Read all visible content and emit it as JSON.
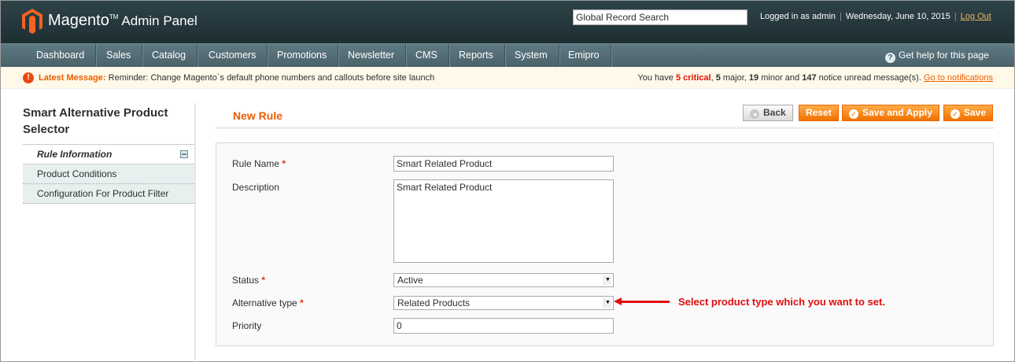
{
  "header": {
    "brand": "Magento",
    "brand_suffix": "Admin Panel",
    "search_value": "Global Record Search",
    "logged_in": "Logged in as admin",
    "date": "Wednesday, June 10, 2015",
    "logout": "Log Out"
  },
  "nav": {
    "items": [
      "Dashboard",
      "Sales",
      "Catalog",
      "Customers",
      "Promotions",
      "Newsletter",
      "CMS",
      "Reports",
      "System",
      "Emipro"
    ],
    "help": "Get help for this page"
  },
  "message": {
    "latest_label": "Latest Message:",
    "latest_text": "Reminder: Change Magento`s default phone numbers and callouts before site launch",
    "prefix": "You have",
    "critical_count": "5 critical",
    "major_count": "5",
    "major_label": "major,",
    "minor_count": "19",
    "minor_label": "minor and",
    "notice_count": "147",
    "notice_label": "notice unread message(s).",
    "link": "Go to notifications"
  },
  "sidebar": {
    "title": "Smart Alternative Product Selector",
    "tabs": [
      "Rule Information",
      "Product Conditions",
      "Configuration For Product Filter"
    ]
  },
  "main": {
    "title": "New Rule",
    "buttons": {
      "back": "Back",
      "reset": "Reset",
      "save_apply": "Save and Apply",
      "save": "Save"
    },
    "form": {
      "rule_name_label": "Rule Name",
      "rule_name_value": "Smart Related Product",
      "description_label": "Description",
      "description_value": "Smart Related Product",
      "status_label": "Status",
      "status_value": "Active",
      "alt_type_label": "Alternative type",
      "alt_type_value": "Related Products",
      "priority_label": "Priority",
      "priority_value": "0",
      "required_mark": "*"
    }
  },
  "annotation": {
    "text": "Select product type which you want to set."
  },
  "colors": {
    "accent": "#eb5e00",
    "header_bg": "#2e4349",
    "nav_bg": "#5f7a83",
    "annotation": "#e30e0e"
  }
}
